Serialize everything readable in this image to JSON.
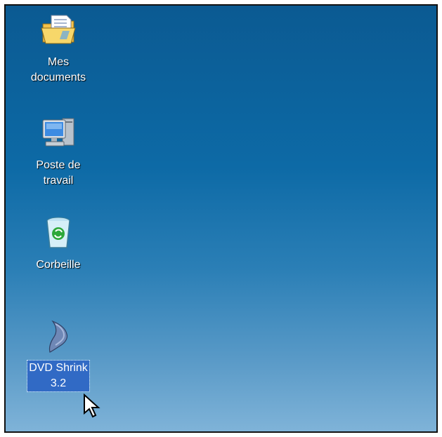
{
  "desktop": {
    "icons": [
      {
        "name": "my-documents",
        "line1": "Mes",
        "line2": "documents"
      },
      {
        "name": "my-computer",
        "line1": "Poste de",
        "line2": "travail"
      },
      {
        "name": "recycle-bin",
        "line1": "Corbeille",
        "line2": ""
      },
      {
        "name": "dvd-shrink",
        "line1": "DVD Shrink",
        "line2": "3.2",
        "selected": true
      }
    ]
  },
  "colors": {
    "desktop_top": "#0b5a92",
    "desktop_bottom": "#7fb3d8",
    "selection": "#316ac5"
  }
}
